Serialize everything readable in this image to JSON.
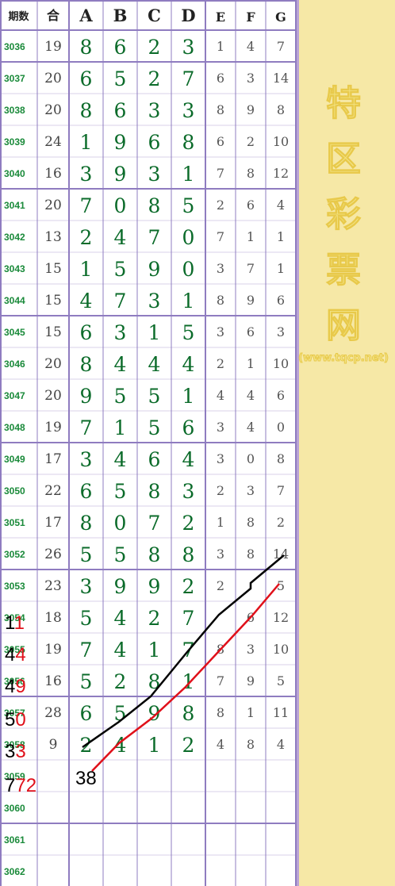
{
  "header": {
    "period": "期数",
    "sum": "合",
    "cols": [
      "A",
      "B",
      "C",
      "D",
      "E",
      "F",
      "G"
    ]
  },
  "rows": [
    {
      "period": "3036",
      "sum": "19",
      "big": [
        "8",
        "6",
        "2",
        "3"
      ],
      "small": [
        "1",
        "4",
        "7"
      ]
    },
    {
      "period": "3037",
      "sum": "20",
      "big": [
        "6",
        "5",
        "2",
        "7"
      ],
      "small": [
        "6",
        "3",
        "14"
      ]
    },
    {
      "period": "3038",
      "sum": "20",
      "big": [
        "8",
        "6",
        "3",
        "3"
      ],
      "small": [
        "8",
        "9",
        "8"
      ]
    },
    {
      "period": "3039",
      "sum": "24",
      "big": [
        "1",
        "9",
        "6",
        "8"
      ],
      "small": [
        "6",
        "2",
        "10"
      ]
    },
    {
      "period": "3040",
      "sum": "16",
      "big": [
        "3",
        "9",
        "3",
        "1"
      ],
      "small": [
        "7",
        "8",
        "12"
      ]
    },
    {
      "period": "3041",
      "sum": "20",
      "big": [
        "7",
        "0",
        "8",
        "5"
      ],
      "small": [
        "2",
        "6",
        "4"
      ]
    },
    {
      "period": "3042",
      "sum": "13",
      "big": [
        "2",
        "4",
        "7",
        "0"
      ],
      "small": [
        "7",
        "1",
        "1"
      ]
    },
    {
      "period": "3043",
      "sum": "15",
      "big": [
        "1",
        "5",
        "9",
        "0"
      ],
      "small": [
        "3",
        "7",
        "1"
      ]
    },
    {
      "period": "3044",
      "sum": "15",
      "big": [
        "4",
        "7",
        "3",
        "1"
      ],
      "small": [
        "8",
        "9",
        "6"
      ]
    },
    {
      "period": "3045",
      "sum": "15",
      "big": [
        "6",
        "3",
        "1",
        "5"
      ],
      "small": [
        "3",
        "6",
        "3"
      ]
    },
    {
      "period": "3046",
      "sum": "20",
      "big": [
        "8",
        "4",
        "4",
        "4"
      ],
      "small": [
        "2",
        "1",
        "10"
      ]
    },
    {
      "period": "3047",
      "sum": "20",
      "big": [
        "9",
        "5",
        "5",
        "1"
      ],
      "small": [
        "4",
        "4",
        "6"
      ]
    },
    {
      "period": "3048",
      "sum": "19",
      "big": [
        "7",
        "1",
        "5",
        "6"
      ],
      "small": [
        "3",
        "4",
        "0"
      ]
    },
    {
      "period": "3049",
      "sum": "17",
      "big": [
        "3",
        "4",
        "6",
        "4"
      ],
      "small": [
        "3",
        "0",
        "8"
      ]
    },
    {
      "period": "3050",
      "sum": "22",
      "big": [
        "6",
        "5",
        "8",
        "3"
      ],
      "small": [
        "2",
        "3",
        "7"
      ]
    },
    {
      "period": "3051",
      "sum": "17",
      "big": [
        "8",
        "0",
        "7",
        "2"
      ],
      "small": [
        "1",
        "8",
        "2"
      ]
    },
    {
      "period": "3052",
      "sum": "26",
      "big": [
        "5",
        "5",
        "8",
        "8"
      ],
      "small": [
        "3",
        "8",
        "14"
      ]
    },
    {
      "period": "3053",
      "sum": "23",
      "big": [
        "3",
        "9",
        "9",
        "2"
      ],
      "small": [
        "2",
        "",
        "5"
      ]
    },
    {
      "period": "3054",
      "sum": "18",
      "big": [
        "5",
        "4",
        "2",
        "7"
      ],
      "small": [
        "",
        "6",
        "12"
      ]
    },
    {
      "period": "3055",
      "sum": "19",
      "big": [
        "7",
        "4",
        "1",
        "7"
      ],
      "small": [
        "8",
        "3",
        "10"
      ]
    },
    {
      "period": "3056",
      "sum": "16",
      "big": [
        "5",
        "2",
        "8",
        "1"
      ],
      "small": [
        "7",
        "9",
        "5"
      ]
    },
    {
      "period": "3057",
      "sum": "28",
      "big": [
        "6",
        "5",
        "9",
        "8"
      ],
      "small": [
        "8",
        "1",
        "11"
      ]
    },
    {
      "period": "3058",
      "sum": "9",
      "big": [
        "2",
        "4",
        "1",
        "2"
      ],
      "small": [
        "4",
        "8",
        "4"
      ]
    },
    {
      "period": "3059",
      "sum": "",
      "big": [
        "",
        "",
        "",
        ""
      ],
      "small": [
        "",
        "",
        ""
      ]
    },
    {
      "period": "3060",
      "sum": "",
      "big": [
        "",
        "",
        "",
        ""
      ],
      "small": [
        "",
        "",
        ""
      ]
    },
    {
      "period": "3061",
      "sum": "",
      "big": [
        "",
        "",
        "",
        ""
      ],
      "small": [
        "",
        "",
        ""
      ]
    },
    {
      "period": "3062",
      "sum": "",
      "big": [
        "",
        "",
        "",
        ""
      ],
      "small": [
        "",
        "",
        ""
      ]
    }
  ],
  "sidebar": {
    "chars": [
      "特",
      "区",
      "彩",
      "票",
      "网"
    ],
    "url": "(www.tqcp.net)",
    "colors": {
      "bg": "#f6e8a6",
      "glyph": "#f3e58a"
    }
  },
  "annotations": [
    {
      "black": "1",
      "red": "1"
    },
    {
      "black": "4",
      "red": "4"
    },
    {
      "black": "4",
      "red": "9"
    },
    {
      "black": "5",
      "red": "0"
    },
    {
      "black": "3",
      "red": "3"
    },
    {
      "black": "7",
      "red": "72"
    }
  ],
  "extra_label": "38",
  "colors": {
    "grid_line": "#8f7cc0",
    "period_text": "#1a8a3a",
    "big_digit": "#0b6b2a",
    "trend_black": "#000000",
    "trend_red": "#e0101a"
  }
}
